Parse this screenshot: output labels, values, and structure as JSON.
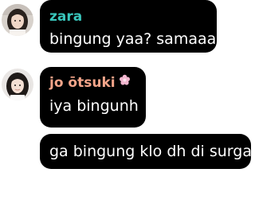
{
  "messages": [
    {
      "sender": "zara",
      "sender_color": "#39c5bb",
      "text": "bingung yaa? samaaa",
      "has_avatar": true
    },
    {
      "sender": "jo ōtsuki",
      "sender_color": "#f4a58a",
      "sender_badge_icon": "pink-flower-icon",
      "text": "iya bingunh",
      "has_avatar": true
    },
    {
      "text": "ga bingung klo dh di surga",
      "has_avatar": false
    }
  ],
  "colors": {
    "bubble": "#000000",
    "message_text": "#ffffff",
    "background": "#ffffff"
  }
}
